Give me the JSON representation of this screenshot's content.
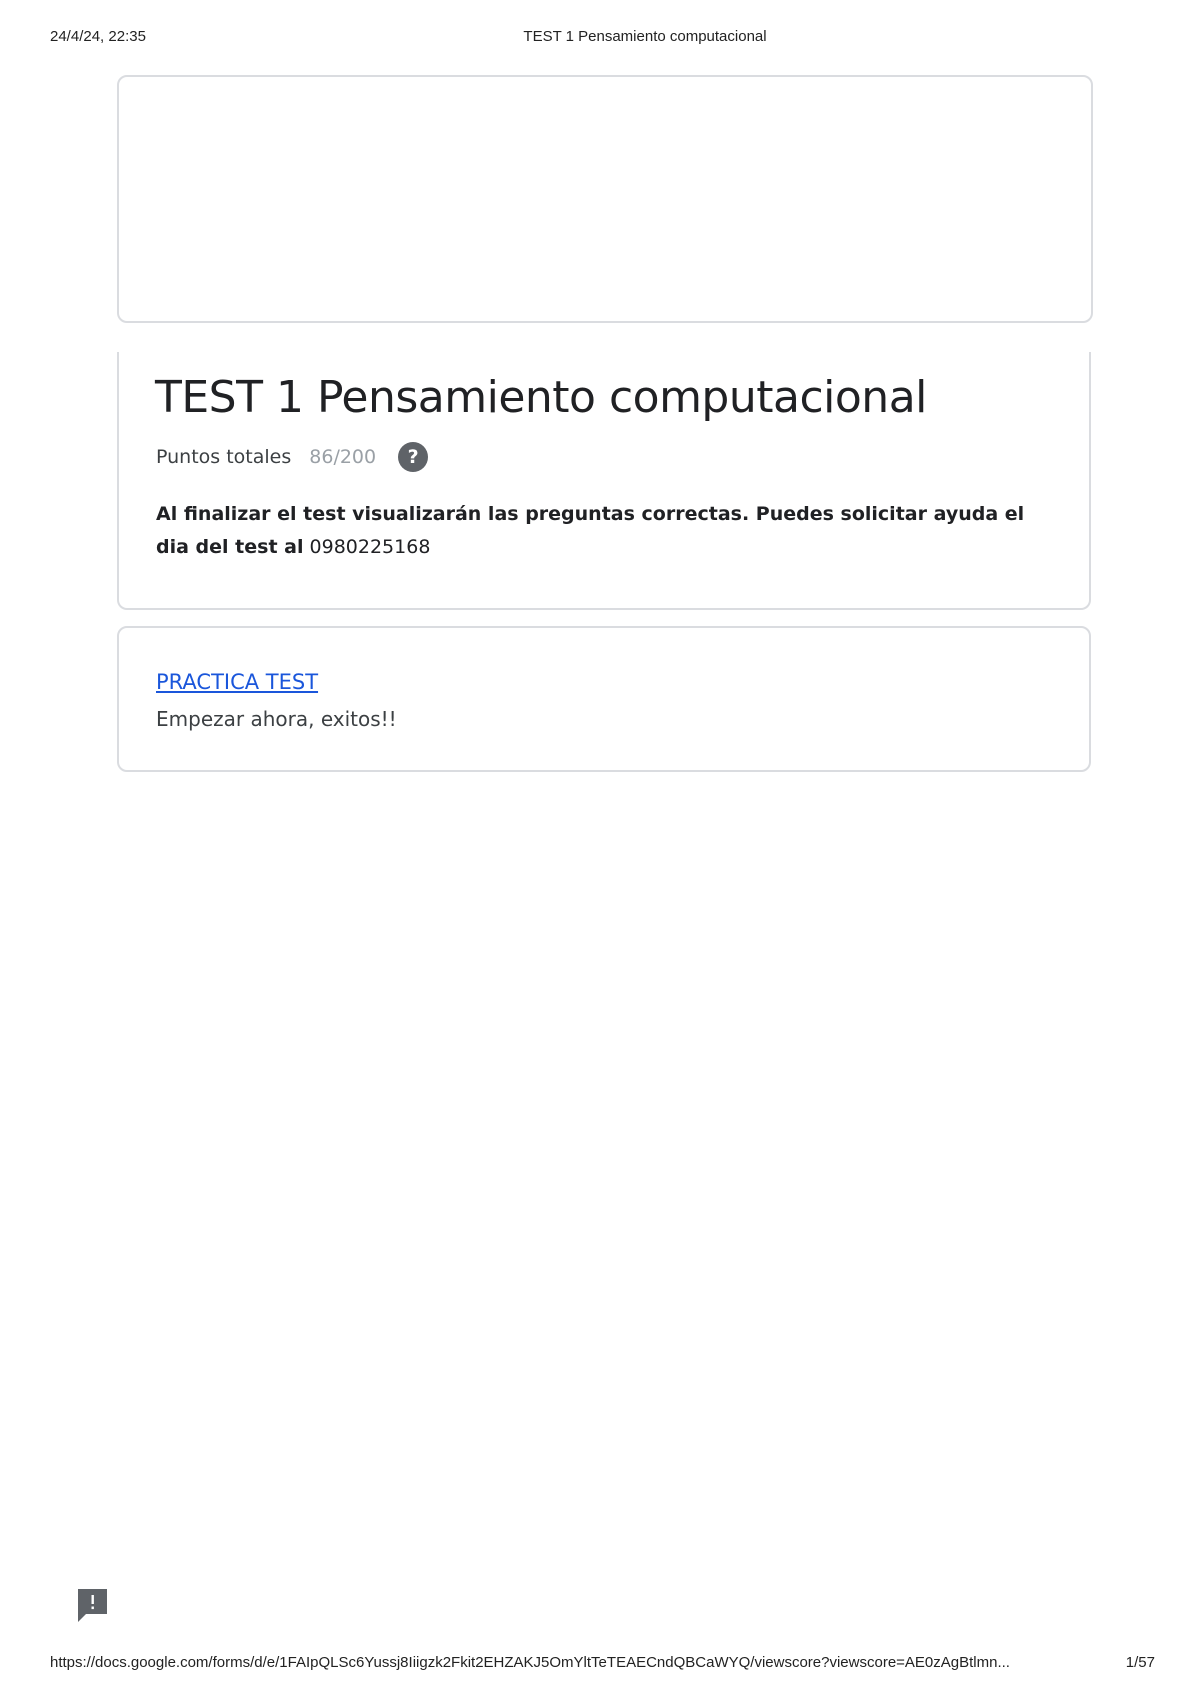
{
  "print_header": {
    "date": "24/4/24, 22:35",
    "title": "TEST 1 Pensamiento computacional"
  },
  "form": {
    "title": "TEST 1 Pensamiento computacional",
    "score_label": "Puntos totales",
    "score_value": "86/200",
    "help_icon": "question-mark-icon",
    "help_glyph": "?",
    "description_bold": "Al finalizar el test visualizarán las preguntas correctas. Puedes solicitar ayuda el dia del test al",
    "description_rest": " 0980225168"
  },
  "section": {
    "link_text": "PRACTICA TEST",
    "description": "Empezar ahora, exitos!!"
  },
  "feedback": {
    "icon": "feedback-icon"
  },
  "print_footer": {
    "url": "https://docs.google.com/forms/d/e/1FAIpQLSc6Yussj8Iiigzk2Fkit2EHZAKJ5OmYltTeTEAECndQBCaWYQ/viewscore?viewscore=AE0zAgBtlmn...",
    "page": "1/57"
  },
  "colors": {
    "card_border": "#dadce0",
    "link": "#1a56db",
    "muted": "#9aa0a6",
    "icon_bg": "#5f6368"
  }
}
